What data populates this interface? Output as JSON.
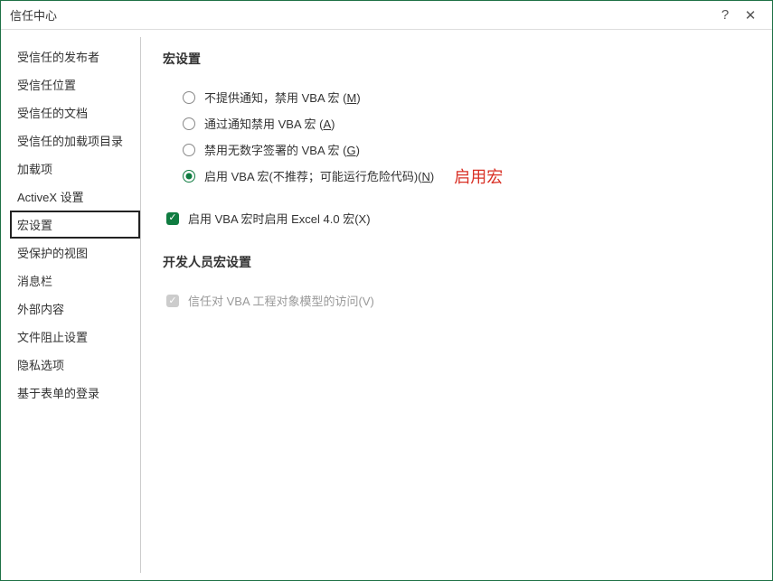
{
  "window": {
    "title": "信任中心",
    "help": "?",
    "close": "✕"
  },
  "sidebar": {
    "items": [
      {
        "label": "受信任的发布者"
      },
      {
        "label": "受信任位置"
      },
      {
        "label": "受信任的文档"
      },
      {
        "label": "受信任的加载项目录"
      },
      {
        "label": "加载项"
      },
      {
        "label": "ActiveX 设置"
      },
      {
        "label": "宏设置"
      },
      {
        "label": "受保护的视图"
      },
      {
        "label": "消息栏"
      },
      {
        "label": "外部内容"
      },
      {
        "label": "文件阻止设置"
      },
      {
        "label": "隐私选项"
      },
      {
        "label": "基于表单的登录"
      }
    ]
  },
  "macro_section": {
    "title": "宏设置",
    "options": [
      {
        "pre": "不提供通知，禁用 VBA 宏 (",
        "key": "M",
        "post": ")"
      },
      {
        "pre": "通过通知禁用 VBA 宏 (",
        "key": "A",
        "post": ")"
      },
      {
        "pre": "禁用无数字签署的 VBA 宏 (",
        "key": "G",
        "post": ")"
      },
      {
        "pre": "启用 VBA 宏(不推荐；可能运行危险代码)(",
        "key": "N",
        "post": ")"
      }
    ],
    "annotation": "启用宏",
    "excel4": {
      "pre": "启用 VBA 宏时启用 Excel 4.0 宏(",
      "key": "X",
      "post": ")"
    }
  },
  "dev_section": {
    "title": "开发人员宏设置",
    "trust_vba": {
      "pre": "信任对 VBA 工程对象模型的访问(",
      "key": "V",
      "post": ")"
    }
  }
}
